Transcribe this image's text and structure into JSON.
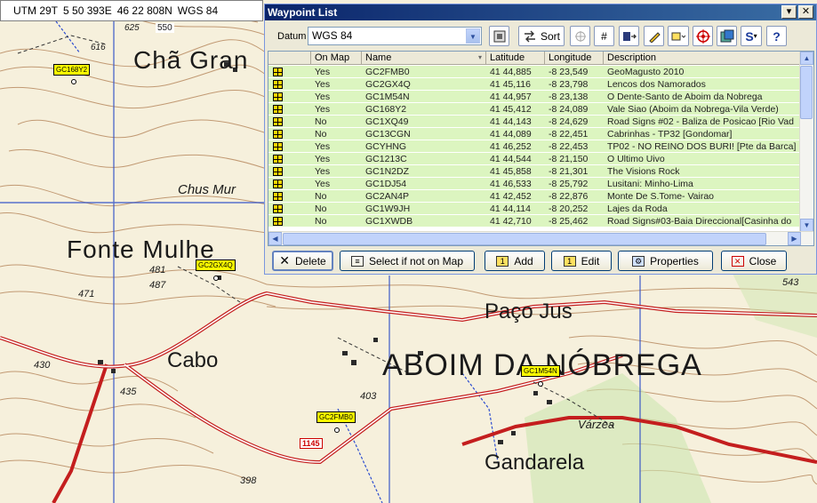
{
  "utm_bar": {
    "zone": "UTM 29T",
    "easting": "5 50 393E",
    "northing": "46 22 808N",
    "datum": "WGS 84"
  },
  "map": {
    "labels": {
      "cha_gran": "Chã Gran",
      "chus_mu": "Chus Mur",
      "fonte_mulhe": "Fonte Mulhe",
      "cabo": "Cabo",
      "paco_jus": "Paço Jus",
      "aboim_da_nobrega": "ABOIM  DA  NÓBREGA",
      "varzea": "Várzea",
      "gandarela": "Gandarela"
    },
    "elevations": {
      "e550": "550",
      "e625": "625",
      "e616": "616",
      "e471": "471",
      "e481": "481",
      "e487": "487",
      "e430": "430",
      "e435": "435",
      "e403": "403",
      "e398": "398",
      "e543": "543"
    },
    "road_number": "1145",
    "waypoint_flags": {
      "gc168y2": "GC168Y2",
      "gc2gx4q": "GC2GX4Q",
      "gc2fmb0": "GC2FMB0",
      "gc1m54n": "GC1M54N"
    },
    "colors": {
      "road": "#c41e1e",
      "contour": "#b07d50",
      "grid": "#3050c8",
      "water": "#2f4fd0"
    }
  },
  "window": {
    "title": "Waypoint List",
    "title_buttons": {
      "pin": "▾",
      "close": "✕"
    },
    "datum_label": "Datum",
    "datum_value": "WGS 84",
    "sort_label": "Sort",
    "columns": [
      "",
      "On Map",
      "Name",
      "Latitude",
      "Longitude",
      "Description"
    ],
    "rows": [
      {
        "onmap": "Yes",
        "name": "GC2FMB0",
        "lat": "41 44,885",
        "lon": "-8 23,549",
        "desc": "GeoMagusto 2010"
      },
      {
        "onmap": "Yes",
        "name": "GC2GX4Q",
        "lat": "41 45,116",
        "lon": "-8 23,798",
        "desc": "Lencos dos Namorados"
      },
      {
        "onmap": "Yes",
        "name": "GC1M54N",
        "lat": "41 44,957",
        "lon": "-8 23,138",
        "desc": "O Dente-Santo de Aboim da Nobrega"
      },
      {
        "onmap": "Yes",
        "name": "GC168Y2",
        "lat": "41 45,412",
        "lon": "-8 24,089",
        "desc": "Vale Siao (Aboim da Nobrega-Vila Verde)"
      },
      {
        "onmap": "No",
        "name": "GC1XQ49",
        "lat": "41 44,143",
        "lon": "-8 24,629",
        "desc": "Road Signs #02 - Baliza de Posicao [Rio Vad"
      },
      {
        "onmap": "No",
        "name": "GC13CGN",
        "lat": "41 44,089",
        "lon": "-8 22,451",
        "desc": "Cabrinhas - TP32 [Gondomar]"
      },
      {
        "onmap": "Yes",
        "name": "GCYHNG",
        "lat": "41 46,252",
        "lon": "-8 22,453",
        "desc": "TP02 - NO REINO DOS BURI! [Pte da Barca]"
      },
      {
        "onmap": "Yes",
        "name": "GC1213C",
        "lat": "41 44,544",
        "lon": "-8 21,150",
        "desc": "O Ultimo Uivo"
      },
      {
        "onmap": "Yes",
        "name": "GC1N2DZ",
        "lat": "41 45,858",
        "lon": "-8 21,301",
        "desc": "The Visions Rock"
      },
      {
        "onmap": "Yes",
        "name": "GC1DJ54",
        "lat": "41 46,533",
        "lon": "-8 25,792",
        "desc": "Lusitani: Minho-Lima"
      },
      {
        "onmap": "No",
        "name": "GC2AN4P",
        "lat": "41 42,452",
        "lon": "-8 22,876",
        "desc": "Monte De S.Tome- Vairao"
      },
      {
        "onmap": "No",
        "name": "GC1W9JH",
        "lat": "41 44,114",
        "lon": "-8 20,252",
        "desc": "Lajes da Roda"
      },
      {
        "onmap": "No",
        "name": "GC1XWDB",
        "lat": "41 42,710",
        "lon": "-8 25,462",
        "desc": "Road Signs#03-Baia Direccional[Casinha do"
      }
    ],
    "buttons": {
      "delete": "Delete",
      "select_if_not": "Select if not on Map",
      "add": "Add",
      "edit": "Edit",
      "properties": "Properties",
      "close": "Close"
    }
  }
}
